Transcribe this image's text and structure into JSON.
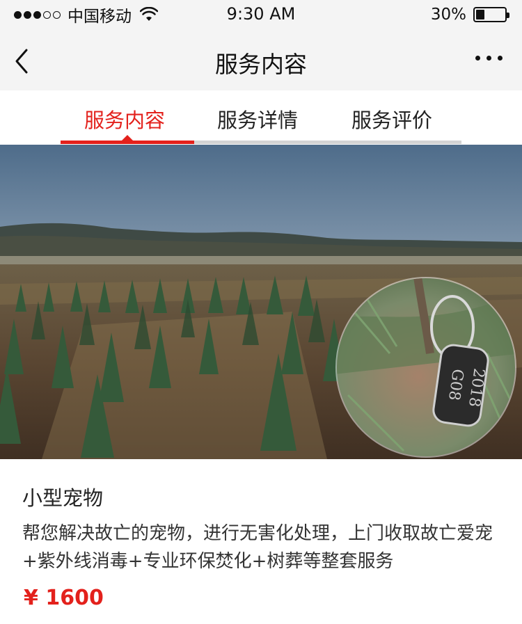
{
  "status_bar": {
    "carrier": "中国移动",
    "time": "9:30 AM",
    "battery": "30%",
    "battery_level": 0.3
  },
  "nav": {
    "title": "服务内容",
    "back_icon": "chevron-left-icon",
    "more_icon": "more-horizontal-icon"
  },
  "tabs": [
    {
      "label": "服务内容",
      "active": true
    },
    {
      "label": "服务详情",
      "active": false
    },
    {
      "label": "服务评价",
      "active": false
    }
  ],
  "hero": {
    "tag_text_line1": "2018",
    "tag_text_line2": "G08"
  },
  "service": {
    "title": "小型宠物",
    "description": "帮您解决故亡的宠物，进行无害化处理，上门收取故亡爱宠+紫外线消毒+专业环保焚化+树葬等整套服务",
    "price": "¥ 1600"
  },
  "colors": {
    "accent": "#e3211c",
    "nav_bg": "#f4f4f4"
  }
}
